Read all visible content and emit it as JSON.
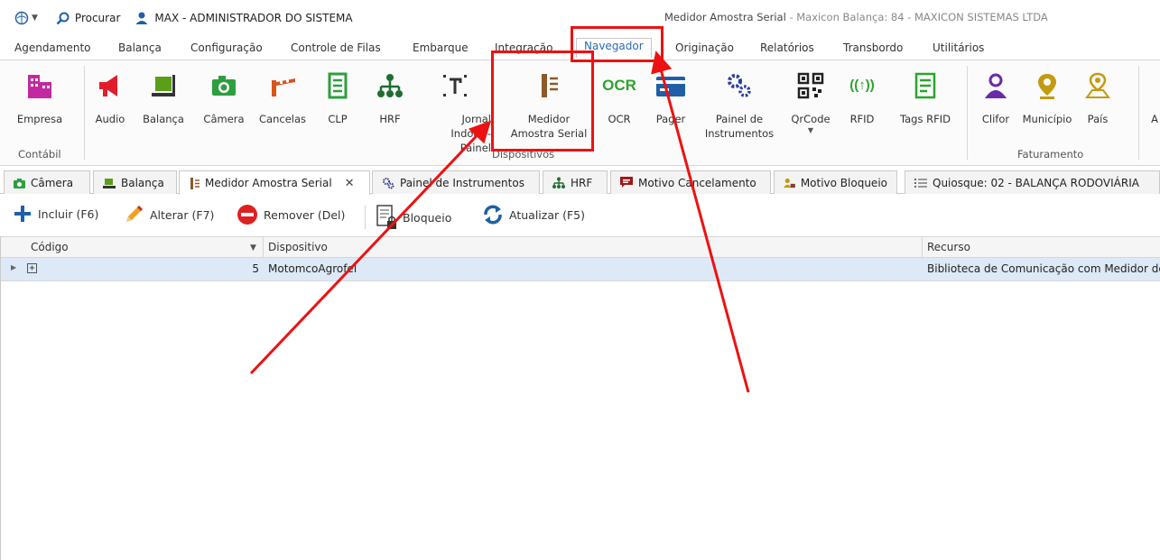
{
  "titlebar": {
    "search_label": "Procurar",
    "user_label": "MAX - ADMINISTRADOR DO SISTEMA",
    "window_title": "Medidor Amostra Serial",
    "window_subtitle": " - Maxicon Balança: 84 - MAXICON SISTEMAS LTDA"
  },
  "menu": [
    "Agendamento",
    "Balança",
    "Configuração",
    "Controle de Filas",
    "Embarque",
    "Integração",
    "Navegador",
    "Originação",
    "Relatórios",
    "Transbordo",
    "Utilitários"
  ],
  "menu_active": "Navegador",
  "ribbon": {
    "buttons": [
      {
        "label": "Empresa",
        "icon": "building-icon",
        "color": "#c229a0"
      },
      {
        "label": "Audio",
        "icon": "megaphone-icon",
        "color": "#e01e2b"
      },
      {
        "label": "Balança",
        "icon": "scale-icon",
        "color": "#5a9e1a"
      },
      {
        "label": "Câmera",
        "icon": "camera-icon",
        "color": "#2e9e3f"
      },
      {
        "label": "Cancelas",
        "icon": "barrier-icon",
        "color": "#d9541a"
      },
      {
        "label": "CLP",
        "icon": "clp-icon",
        "color": "#2e9e3f"
      },
      {
        "label": "HRF",
        "icon": "hierarchy-icon",
        "color": "#1f6e2f"
      },
      {
        "label": "Jornal Indoor - Painel",
        "icon": "text-frame-icon",
        "color": "#333333"
      },
      {
        "label": "Medidor Amostra Serial",
        "icon": "thermometer-icon",
        "color": "#8b5a2b"
      },
      {
        "label": "OCR",
        "icon": "ocr-icon",
        "color": "#2aa52a"
      },
      {
        "label": "Pager",
        "icon": "pager-icon",
        "color": "#1f5fa8"
      },
      {
        "label": "Painel de Instrumentos",
        "icon": "gears-icon",
        "color": "#2b3e9c"
      },
      {
        "label": "QrCode",
        "icon": "qrcode-icon",
        "color": "#222222"
      },
      {
        "label": "RFID",
        "icon": "rfid-icon",
        "color": "#2aa52a"
      },
      {
        "label": "Tags RFID",
        "icon": "tag-list-icon",
        "color": "#2aa52a"
      },
      {
        "label": "Clifor",
        "icon": "person-icon",
        "color": "#6a2aa8"
      },
      {
        "label": "Município",
        "icon": "map-pin-icon",
        "color": "#c49a10"
      },
      {
        "label": "País",
        "icon": "location-icon",
        "color": "#c49a10"
      },
      {
        "label": "A",
        "icon": "",
        "color": "#333333"
      }
    ],
    "groups": {
      "contabil": "Contábil",
      "dispositivos": "Dispositivos",
      "faturamento": "Faturamento"
    }
  },
  "doc_tabs": [
    {
      "label": "Câmera",
      "icon": "camera-icon"
    },
    {
      "label": "Balança",
      "icon": "scale-icon"
    },
    {
      "label": "Medidor Amostra Serial",
      "icon": "thermometer-icon",
      "close": "✕"
    },
    {
      "label": "Painel de Instrumentos",
      "icon": "gears-icon"
    },
    {
      "label": "HRF",
      "icon": "hierarchy-icon"
    },
    {
      "label": "Motivo Cancelamento",
      "icon": "comment-icon"
    },
    {
      "label": "Motivo Bloqueio",
      "icon": "person-lock-icon"
    },
    {
      "label": "Quiosque: 02 - BALANÇA RODOVIÁRIA",
      "icon": "list-icon"
    }
  ],
  "toolbar": {
    "add": "Incluir (F6)",
    "edit": "Alterar (F7)",
    "remove": "Remover (Del)",
    "block": "Bloqueio",
    "refresh": "Atualizar (F5)"
  },
  "grid": {
    "columns": [
      "Código",
      "Dispositivo",
      "Recurso"
    ],
    "rows": [
      {
        "codigo": "5",
        "dispositivo": "MotomcoAgrofel",
        "recurso": "Biblioteca de Comunicação com Medidor de U"
      }
    ]
  },
  "colors": {
    "accent": "#2b6cb0",
    "annotation": "#ee1111",
    "row_selected": "#dde9f6"
  }
}
